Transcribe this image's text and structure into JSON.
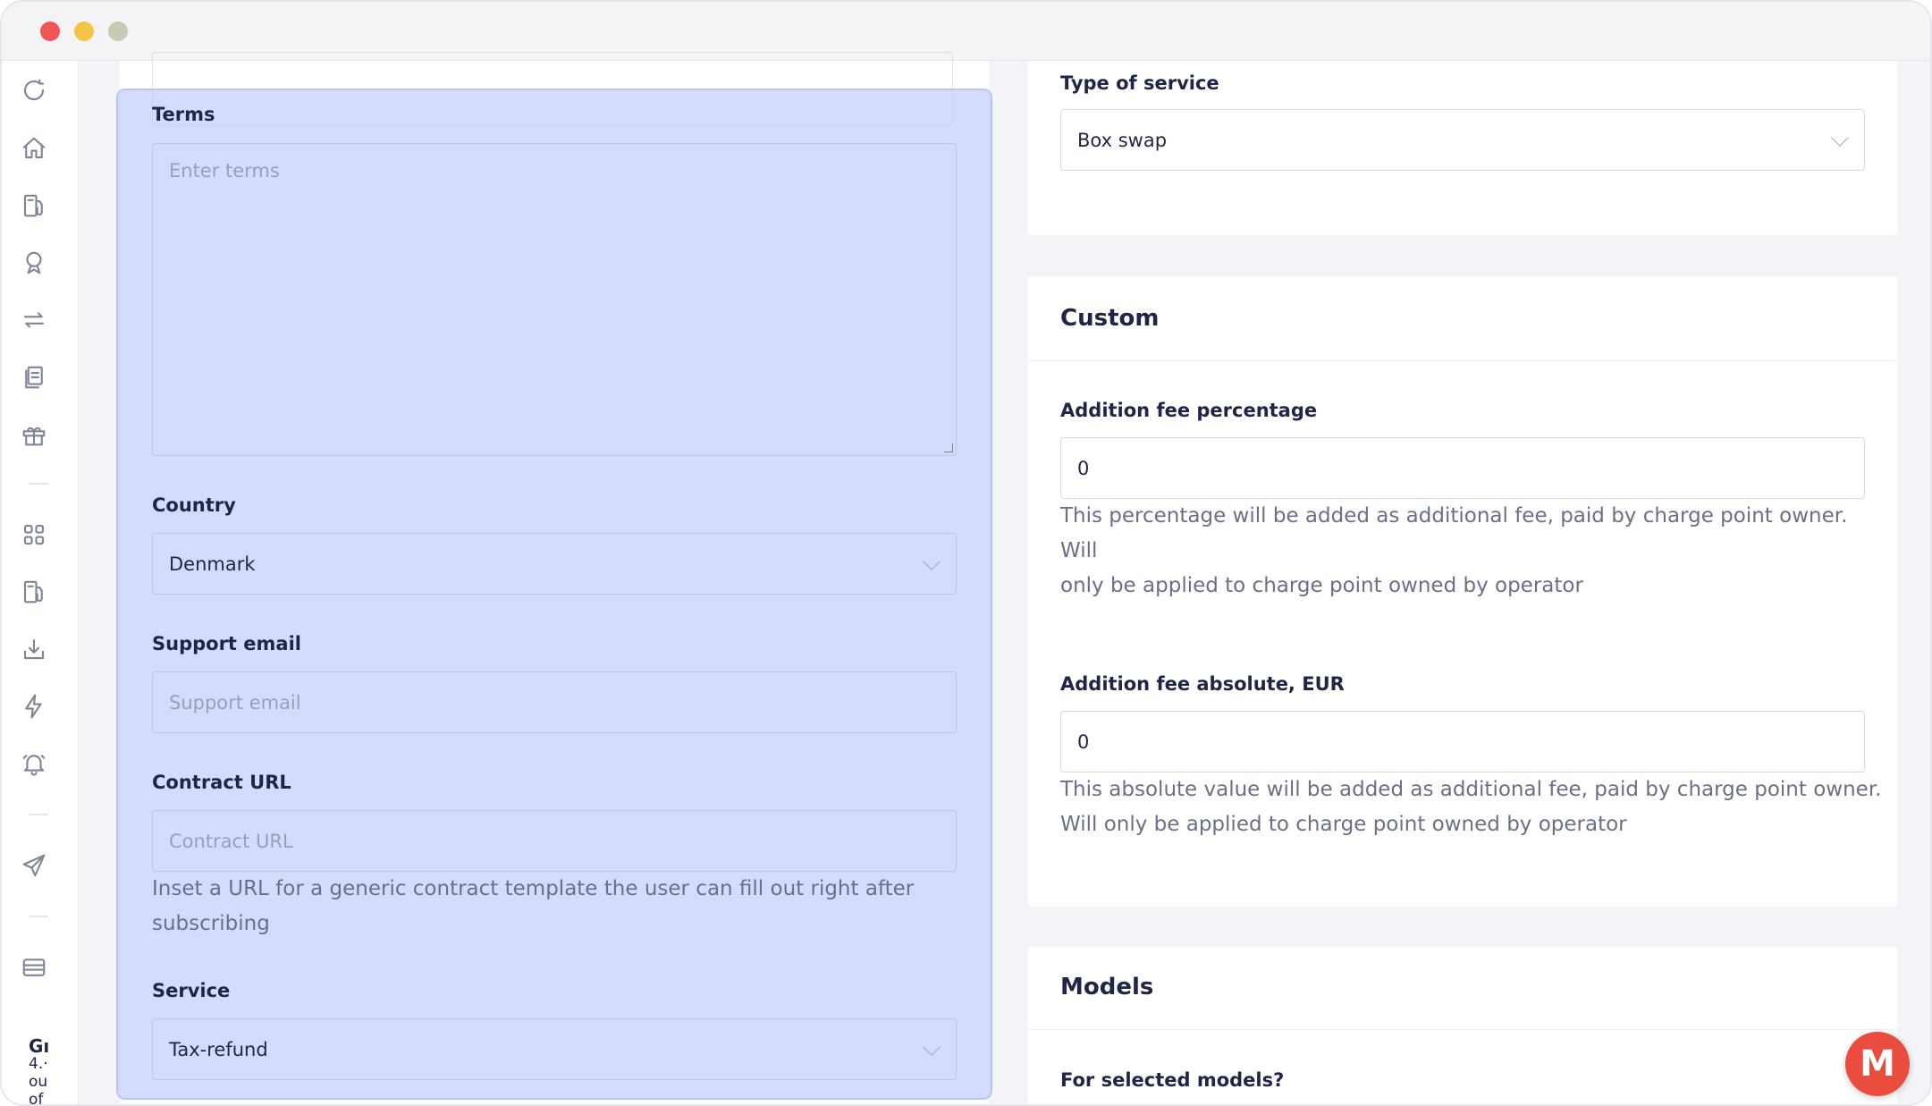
{
  "left_form": {
    "terms": {
      "label": "Terms",
      "placeholder": "Enter terms",
      "value": ""
    },
    "country": {
      "label": "Country",
      "value": "Denmark"
    },
    "support_email": {
      "label": "Support email",
      "placeholder": "Support email",
      "value": ""
    },
    "contract_url": {
      "label": "Contract URL",
      "placeholder": "Contract URL",
      "help_line1": "Inset a URL for a generic contract template the user can fill out right after",
      "help_line2": "subscribing"
    },
    "service": {
      "label": "Service",
      "value": "Tax-refund"
    }
  },
  "right_top": {
    "type_of_service": {
      "label": "Type of service",
      "value": "Box swap"
    }
  },
  "custom": {
    "title": "Custom",
    "addition_fee_percentage": {
      "label": "Addition fee percentage",
      "value": "0",
      "help_line1": "This percentage will be added as additional fee, paid by charge point owner. Will",
      "help_line2": "only be applied to charge point owned by operator"
    },
    "addition_fee_absolute": {
      "label": "Addition fee absolute, EUR",
      "value": "0",
      "help_line1": "This absolute value will be added as additional fee, paid by charge point owner.",
      "help_line2": "Will only be applied to charge point owned by operator"
    }
  },
  "models": {
    "title": "Models",
    "for_selected_label": "For selected models?"
  },
  "sidebar": {
    "icons": [
      "refresh-icon",
      "home-icon",
      "fuel-station-icon",
      "badge-icon",
      "swap-icon",
      "documents-icon",
      "gift-icon",
      "grid-icon",
      "fuel-station-icon",
      "download-icon",
      "bolt-icon",
      "bell-icon",
      "send-icon",
      "card-icon"
    ],
    "footer_line1": "Gı",
    "footer_line2": "4.·",
    "footer_line3": "ou",
    "footer_line4": "of"
  },
  "fab": {
    "label": "M"
  },
  "colors": {
    "highlight": "#c4cefc",
    "fab": "#ea4d3d",
    "text": "#1f2547",
    "help_text": "#697087"
  }
}
